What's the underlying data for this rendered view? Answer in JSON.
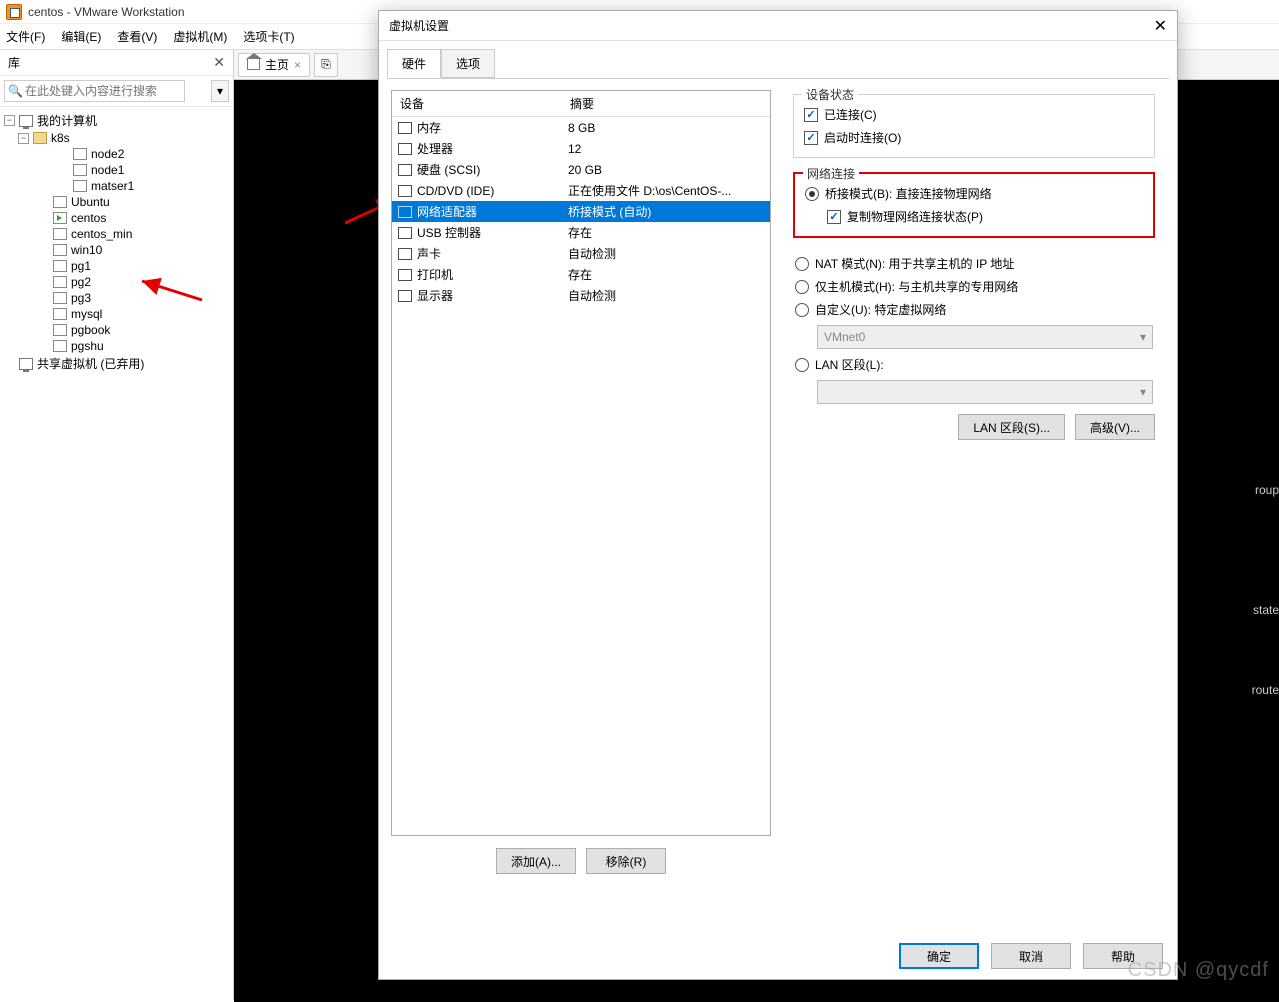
{
  "titlebar": {
    "title": "centos - VMware Workstation"
  },
  "menu": {
    "file": "文件(F)",
    "edit": "编辑(E)",
    "view": "查看(V)",
    "vm": "虚拟机(M)",
    "tabs": "选项卡(T)"
  },
  "library": {
    "title": "库",
    "search_placeholder": "在此处键入内容进行搜索",
    "my_computer": "我的计算机",
    "k8s": "k8s",
    "node2": "node2",
    "node1": "node1",
    "master1": "matser1",
    "ubuntu": "Ubuntu",
    "centos": "centos",
    "centos_min": "centos_min",
    "win10": "win10",
    "pg1": "pg1",
    "pg2": "pg2",
    "pg3": "pg3",
    "mysql": "mysql",
    "pgbook": "pgbook",
    "pgshu": "pgshu",
    "shared": "共享虚拟机 (已弃用)"
  },
  "tabs": {
    "home": "主页"
  },
  "terminal": {
    "l1": "roup",
    "l2": "state",
    "l3": "route"
  },
  "dialog": {
    "title": "虚拟机设置",
    "tab_hw": "硬件",
    "tab_opt": "选项",
    "col_dev": "设备",
    "col_sum": "摘要",
    "rows": [
      {
        "dev": "内存",
        "sum": "8 GB"
      },
      {
        "dev": "处理器",
        "sum": "12"
      },
      {
        "dev": "硬盘 (SCSI)",
        "sum": "20 GB"
      },
      {
        "dev": "CD/DVD (IDE)",
        "sum": "正在使用文件 D:\\os\\CentOS-..."
      },
      {
        "dev": "网络适配器",
        "sum": "桥接模式 (自动)"
      },
      {
        "dev": "USB 控制器",
        "sum": "存在"
      },
      {
        "dev": "声卡",
        "sum": "自动检测"
      },
      {
        "dev": "打印机",
        "sum": "存在"
      },
      {
        "dev": "显示器",
        "sum": "自动检测"
      }
    ],
    "add": "添加(A)...",
    "remove": "移除(R)",
    "dev_state": "设备状态",
    "connected": "已连接(C)",
    "connect_poweron": "启动时连接(O)",
    "net_conn": "网络连接",
    "bridge": "桥接模式(B): 直接连接物理网络",
    "replicate": "复制物理网络连接状态(P)",
    "nat": "NAT 模式(N): 用于共享主机的 IP 地址",
    "hostonly": "仅主机模式(H): 与主机共享的专用网络",
    "custom": "自定义(U): 特定虚拟网络",
    "vmnet": "VMnet0",
    "lan": "LAN 区段(L):",
    "lan_btn": "LAN 区段(S)...",
    "adv_btn": "高级(V)...",
    "ok": "确定",
    "cancel": "取消",
    "help": "帮助"
  },
  "watermark": "CSDN @qycdf"
}
